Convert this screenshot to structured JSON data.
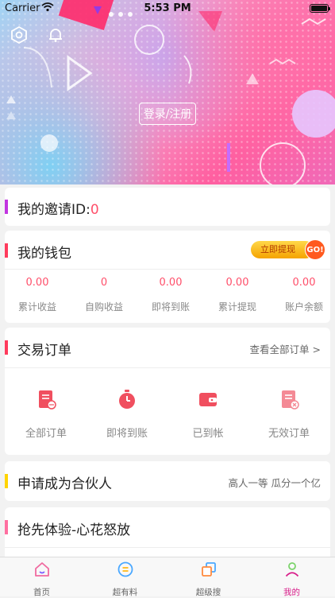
{
  "status_bar": {
    "carrier": "Carrier",
    "time": "5:53 PM"
  },
  "hero": {
    "login_label": "登录/注册",
    "settings_icon": "settings-hexagon-icon",
    "bell_icon": "bell-icon"
  },
  "invite": {
    "label": "我的邀请ID:",
    "value": "0",
    "accent": "#c235e0"
  },
  "wallet": {
    "title": "我的钱包",
    "withdraw_label": "立即提现",
    "withdraw_badge": "GO!",
    "stats": [
      {
        "value": "0.00",
        "label": "累计收益"
      },
      {
        "value": "0",
        "label": "自购收益"
      },
      {
        "value": "0.00",
        "label": "即将到账"
      },
      {
        "value": "0.00",
        "label": "累计提现"
      },
      {
        "value": "0.00",
        "label": "账户余额"
      }
    ]
  },
  "orders": {
    "title": "交易订单",
    "view_all": "查看全部订单 >",
    "items": [
      {
        "label": "全部订单",
        "icon": "all-orders-icon"
      },
      {
        "label": "即将到账",
        "icon": "stopwatch-icon"
      },
      {
        "label": "已到帐",
        "icon": "wallet-icon"
      },
      {
        "label": "无效订单",
        "icon": "invalid-order-icon"
      }
    ]
  },
  "partner": {
    "title": "申请成为合伙人",
    "slogan": "高人一等  瓜分一个亿"
  },
  "trial": {
    "title": "抢先体验-心花怒放"
  },
  "tabbar": {
    "items": [
      {
        "label": "首页",
        "icon": "home-icon"
      },
      {
        "label": "超有料",
        "icon": "coin-icon"
      },
      {
        "label": "超级搜",
        "icon": "layers-icon"
      },
      {
        "label": "我的",
        "icon": "profile-icon",
        "active": true
      }
    ]
  },
  "colors": {
    "accent_red": "#ff4f6a",
    "active_tab": "#d81e8a"
  }
}
